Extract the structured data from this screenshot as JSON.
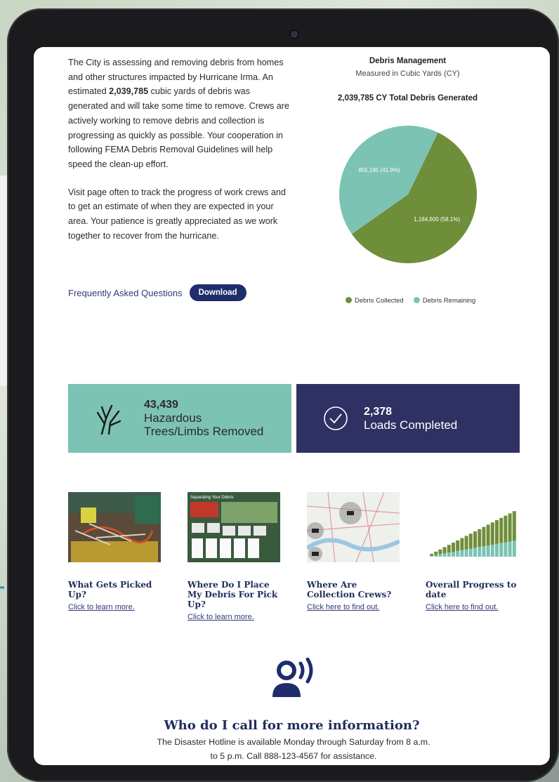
{
  "intro": {
    "p1_before": "The City is assessing and removing debris from homes and other structures impacted by Hurricane Irma. An estimated ",
    "p1_bold": "2,039,785",
    "p1_after": " cubic yards of debris was generated and will take some time to remove. Crews are actively working to remove debris and collection is progressing as quickly as possible. Your cooperation in following FEMA Debris Removal Guidelines will help speed the clean-up effort.",
    "p2": "Visit page often to track the progress of work crews and to get an estimate of when they are expected in your area. Your patience is greatly appreciated as we work together to recover from the hurricane.",
    "faq_link": "Frequently Asked Questions",
    "download_button": "Download"
  },
  "chart_data": {
    "type": "pie",
    "title": "Debris Management",
    "subtitle": "Measured in Cubic Yards (CY)",
    "total_label": "2,039,785 CY Total Debris Generated",
    "categories": [
      "Debris Collected",
      "Debris Remaining"
    ],
    "values": [
      1184600,
      855185
    ],
    "data_labels": [
      "1,184,600 (58.1%)",
      "855,185 (41.9%)"
    ],
    "colors": [
      "#6f8e3a",
      "#7cc3b3"
    ],
    "legend_position": "bottom"
  },
  "stats": [
    {
      "number": "43,439",
      "label_line1": "Hazardous",
      "label_line2": "Trees/Limbs Removed",
      "icon": "tree-limbs-icon"
    },
    {
      "number": "2,378",
      "label_line1": "Loads Completed",
      "icon": "check-circle-icon"
    }
  ],
  "cards": [
    {
      "title": "What Gets Picked Up?",
      "link": "Click to learn more."
    },
    {
      "title": "Where Do I Place My Debris For Pick Up?",
      "link": "Click to learn more."
    },
    {
      "title": "Where Are Collection Crews?",
      "link": "Click here to find out."
    },
    {
      "title": "Overall Progress to date",
      "link": "Click here to find out."
    }
  ],
  "flyer": {
    "heading": "Separating Your Debris"
  },
  "hotline": {
    "title": "Who do I call for more information?",
    "text": "The Disaster Hotline is available Monday through Saturday from 8 a.m. to 5 p.m. Call 888-123-4567 for assistance."
  },
  "colors": {
    "navy": "#2f3163",
    "teal": "#7cc3b3",
    "green": "#6f8e3a",
    "link": "#2f3a7a"
  }
}
